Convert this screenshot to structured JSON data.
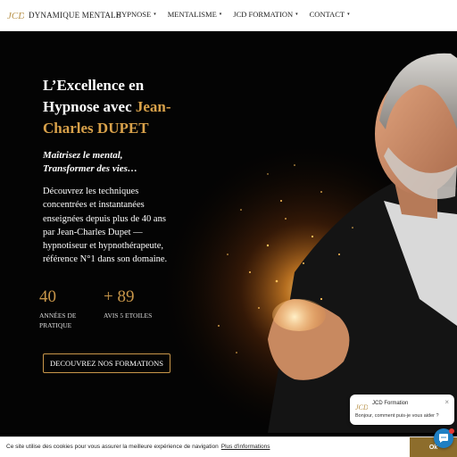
{
  "brand": {
    "name": "DYNAMIQUE MENTALE",
    "logo_icon": "jcd-logo-icon"
  },
  "nav": {
    "items": [
      {
        "label": "HYPNOSE"
      },
      {
        "label": "MENTALISME"
      },
      {
        "label": "JCD FORMATION"
      },
      {
        "label": "CONTACT"
      }
    ],
    "caret": "▾"
  },
  "hero": {
    "headline_part1": "L’Excellence en Hypnose avec ",
    "headline_accent": "Jean-Charles DUPET",
    "tagline_line1": "Maîtrisez le mental,",
    "tagline_line2": "Transformer des vies…",
    "description": "Découvrez les techniques concentrées et instantanées enseignées depuis plus de 40 ans par Jean-Charles Dupet — hypnotiseur et hypnothérapeute, référence N°1 dans son domaine.",
    "stats": [
      {
        "value": "40",
        "label": "ANNÉES DE PRATIQUE"
      },
      {
        "value": "+ 89",
        "label": "AVIS 5 ETOILES"
      }
    ],
    "cta_label": "DECOUVREZ NOS FORMATIONS"
  },
  "chat": {
    "title": "JCD Formation",
    "message": "Bonjour, comment puis-je vous aider ?",
    "close": "×"
  },
  "cookie": {
    "text": "Ce site utilise des cookies pour vous assurer la meilleure expérience de navigation",
    "link": "Plus d'informations",
    "ok": "Ok"
  },
  "colors": {
    "accent": "#c9974a",
    "cookie_button": "#8d6d2c",
    "chat_fab": "#1f7fc3"
  }
}
